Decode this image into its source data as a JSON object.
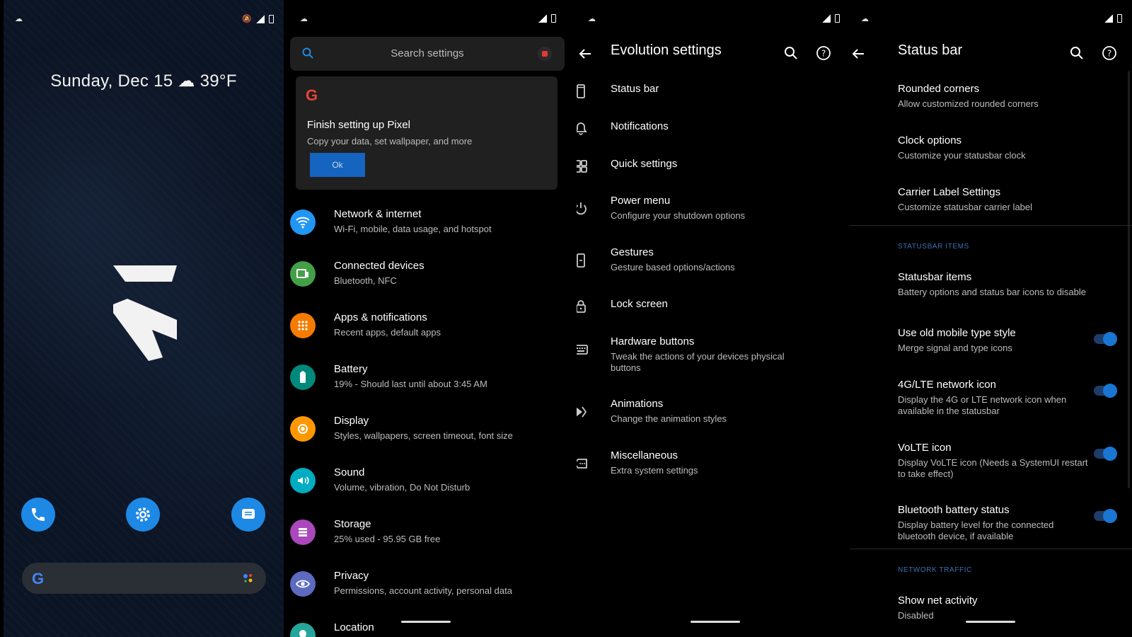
{
  "launcher": {
    "date_weather": "Sunday, Dec 15 ☁ 39°F",
    "dock": [
      "phone-icon",
      "settings-gear-icon",
      "messages-icon"
    ],
    "search_logo": "G"
  },
  "settings": {
    "search_placeholder": "Search settings",
    "card": {
      "logo": "G",
      "title": "Finish setting up Pixel",
      "subtitle": "Copy your data, set wallpaper, and more",
      "button": "Ok"
    },
    "items": [
      {
        "title": "Network & internet",
        "subtitle": "Wi-Fi, mobile, data usage, and hotspot",
        "color": "#2196f3"
      },
      {
        "title": "Connected devices",
        "subtitle": "Bluetooth, NFC",
        "color": "#43a047"
      },
      {
        "title": "Apps & notifications",
        "subtitle": "Recent apps, default apps",
        "color": "#f57c00"
      },
      {
        "title": "Battery",
        "subtitle": "19% - Should last until about 3:45 AM",
        "color": "#00897b"
      },
      {
        "title": "Display",
        "subtitle": "Styles, wallpapers, screen timeout, font size",
        "color": "#ff9800"
      },
      {
        "title": "Sound",
        "subtitle": "Volume, vibration, Do Not Disturb",
        "color": "#00acc1"
      },
      {
        "title": "Storage",
        "subtitle": "25% used - 95.95 GB free",
        "color": "#ab47bc"
      },
      {
        "title": "Privacy",
        "subtitle": "Permissions, account activity, personal data",
        "color": "#5c6bc0"
      },
      {
        "title": "Location",
        "subtitle": "",
        "color": "#26a69a"
      }
    ]
  },
  "evolution": {
    "title": "Evolution settings",
    "items": [
      {
        "title": "Status bar",
        "subtitle": ""
      },
      {
        "title": "Notifications",
        "subtitle": ""
      },
      {
        "title": "Quick settings",
        "subtitle": ""
      },
      {
        "title": "Power menu",
        "subtitle": "Configure your shutdown options"
      },
      {
        "title": "Gestures",
        "subtitle": "Gesture based options/actions"
      },
      {
        "title": "Lock screen",
        "subtitle": ""
      },
      {
        "title": "Hardware buttons",
        "subtitle": "Tweak the actions of your devices physical buttons"
      },
      {
        "title": "Animations",
        "subtitle": "Change the animation styles"
      },
      {
        "title": "Miscellaneous",
        "subtitle": "Extra system settings"
      }
    ]
  },
  "statusbar_page": {
    "title": "Status bar",
    "top_items": [
      {
        "title": "Rounded corners",
        "subtitle": "Allow customized rounded corners"
      },
      {
        "title": "Clock options",
        "subtitle": "Customize your statusbar clock"
      },
      {
        "title": "Carrier Label Settings",
        "subtitle": "Customize statusbar carrier label"
      }
    ],
    "section1": "STATUSBAR ITEMS",
    "items": [
      {
        "title": "Statusbar items",
        "subtitle": "Battery options and status bar icons to disable",
        "toggle": false
      },
      {
        "title": "Use old mobile type style",
        "subtitle": "Merge signal and type icons",
        "toggle": true
      },
      {
        "title": "4G/LTE network icon",
        "subtitle": "Display the 4G or LTE network icon when available in the statusbar",
        "toggle": true
      },
      {
        "title": "VoLTE icon",
        "subtitle": "Display VoLTE icon (Needs a SystemUI restart to take effect)",
        "toggle": true
      },
      {
        "title": "Bluetooth battery status",
        "subtitle": "Display battery level for the connected bluetooth device, if available",
        "toggle": true
      }
    ],
    "section2": "NETWORK TRAFFIC",
    "net": {
      "title": "Show net activity",
      "subtitle": "Disabled"
    }
  },
  "colors": {
    "accent": "#1976d2",
    "section": "#3f6fb0"
  }
}
